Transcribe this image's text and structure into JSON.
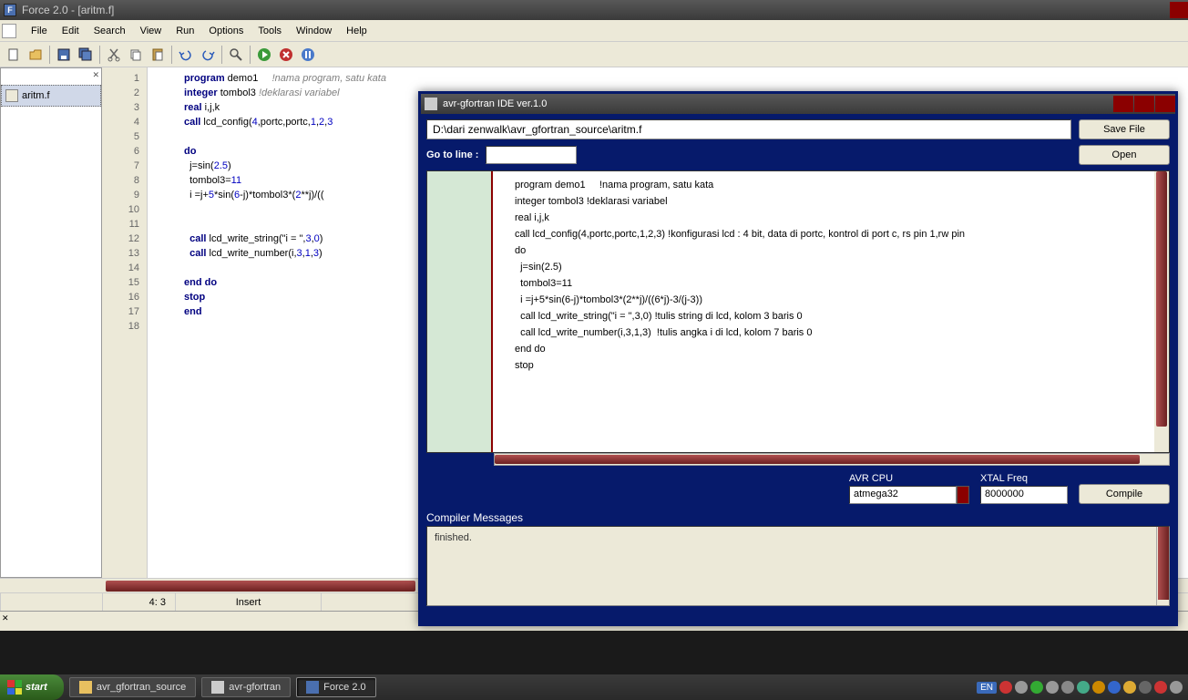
{
  "force": {
    "title": "Force 2.0 - [aritm.f]",
    "menu": {
      "file": "File",
      "edit": "Edit",
      "search": "Search",
      "view": "View",
      "run": "Run",
      "options": "Options",
      "tools": "Tools",
      "window": "Window",
      "help": "Help"
    },
    "filetree": {
      "filename": "aritm.f"
    },
    "gutter_lines": [
      "1",
      "2",
      "3",
      "4",
      "5",
      "6",
      "7",
      "8",
      "9",
      "10",
      "11",
      "12",
      "13",
      "14",
      "15",
      "16",
      "17",
      "18"
    ],
    "code": {
      "l1a": "program",
      "l1b": " demo1     ",
      "l1c": "!nama program, satu kata",
      "l2a": "integer",
      "l2b": " tombol3 ",
      "l2c": "!deklarasi variabel",
      "l3a": "real",
      "l3b": " i,j,k",
      "l4a": "call",
      "l4b": " lcd_config(",
      "l4c": "4",
      "l4d": ",portc,portc,",
      "l4e": "1",
      "l4f": ",",
      "l4g": "2",
      "l4h": ",",
      "l4i": "3",
      "l6a": "do",
      "l7a": "  j=sin(",
      "l7b": "2.5",
      "l7c": ")",
      "l8a": "  tombol3=",
      "l8b": "11",
      "l9a": "  i =j+",
      "l9b": "5",
      "l9c": "*sin(",
      "l9d": "6",
      "l9e": "-j)*tombol3*(",
      "l9f": "2",
      "l9g": "**j)/((",
      "l12a": "  call",
      "l12b": " lcd_write_string(\"i = \",",
      "l12c": "3",
      "l12d": ",",
      "l12e": "0",
      "l12f": ")",
      "l13a": "  call",
      "l13b": " lcd_write_number(i,",
      "l13c": "3",
      "l13d": ",",
      "l13e": "1",
      "l13f": ",",
      "l13g": "3",
      "l13h": ")",
      "l15a": "end do",
      "l16a": "stop",
      "l17a": "end"
    },
    "status": {
      "pos": "4:  3",
      "mode": "Insert"
    }
  },
  "avr": {
    "title": "avr-gfortran IDE ver.1.0",
    "path": "D:\\dari zenwalk\\avr_gfortran_source\\aritm.f",
    "save_btn": "Save File",
    "open_btn": "Open",
    "goto_label": "Go to line :",
    "code_lines": [
      "program demo1     !nama program, satu kata",
      "integer tombol3 !deklarasi variabel",
      "real i,j,k",
      "call lcd_config(4,portc,portc,1,2,3) !konfigurasi lcd : 4 bit, data di portc, kontrol di port c, rs pin 1,rw pin",
      "",
      "do",
      "  j=sin(2.5)",
      "  tombol3=11",
      "  i =j+5*sin(6-j)*tombol3*(2**j)/((6*j)-3/(j-3))",
      "",
      "",
      "  call lcd_write_string(\"i = \",3,0) !tulis string di lcd, kolom 3 baris 0",
      "  call lcd_write_number(i,3,1,3)  !tulis angka i di lcd, kolom 7 baris 0",
      "",
      "end do",
      "stop"
    ],
    "cpu_label": "AVR CPU",
    "cpu_value": "atmega32",
    "xtal_label": "XTAL Freq",
    "xtal_value": "8000000",
    "compile_btn": "Compile",
    "msgs_label": "Compiler Messages",
    "msgs_text": "finished."
  },
  "taskbar": {
    "start": "start",
    "task1": "avr_gfortran_source",
    "task2": "avr-gfortran",
    "task3": "Force 2.0",
    "lang": "EN"
  }
}
